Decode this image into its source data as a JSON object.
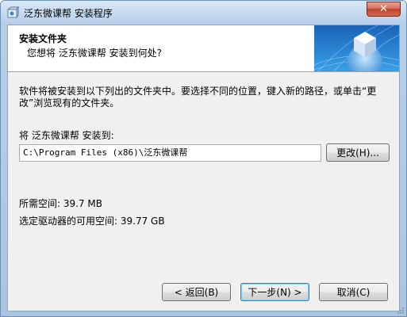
{
  "window": {
    "title": "泛东微课帮 安装程序",
    "close_glyph": "✕"
  },
  "header": {
    "title": "安装文件夹",
    "subtitle": "您想将 泛东微课帮 安装到何处?"
  },
  "body": {
    "description": "软件将被安装到以下列出的文件夹中。要选择不同的位置，键入新的路径，或单击“更改”浏览现有的文件夹。",
    "install_label": "将 泛东微课帮 安装到:",
    "install_path": "C:\\Program Files (x86)\\泛东微课帮",
    "browse_label": "更改(H)...",
    "space_required": "所需空间: 39.7 MB",
    "space_available": "选定驱动器的可用空间: 39.77 GB"
  },
  "buttons": {
    "back": "< 返回(B)",
    "next": "下一步(N) >",
    "cancel": "取消(C)"
  },
  "colors": {
    "title_bar": "#c4d9ef",
    "close_button": "#c0412a",
    "dialog_background": "#f0f0f0",
    "default_button_border": "#3c7fb1"
  },
  "icons": {
    "app": "installer-box-icon",
    "header_graphic": "globe-cube-graphic",
    "resize": "resize-grip-icon"
  }
}
